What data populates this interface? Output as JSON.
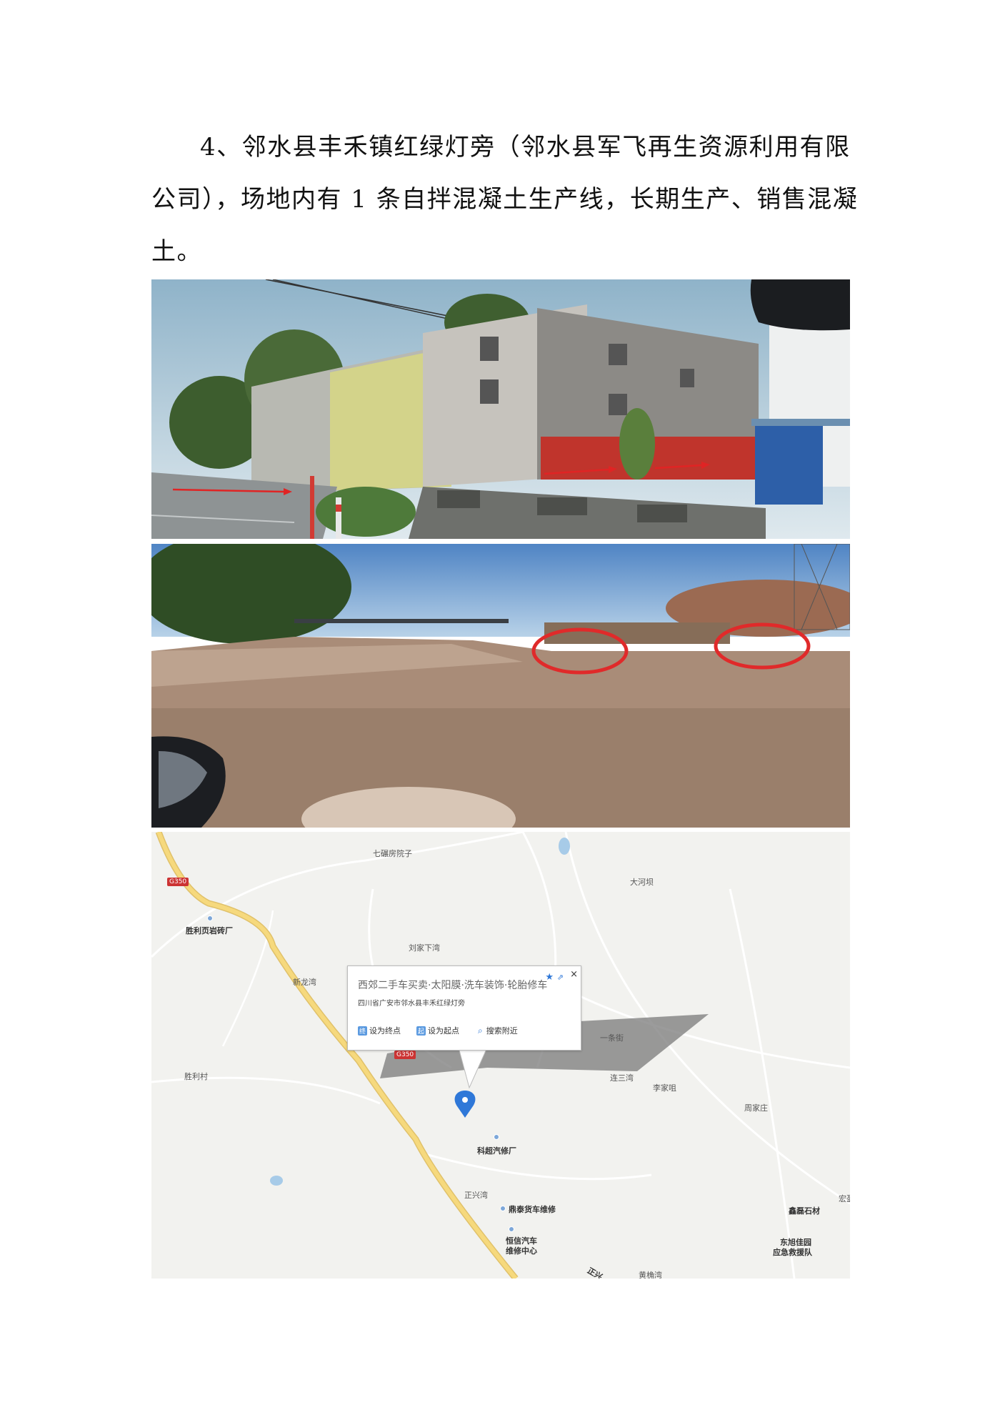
{
  "paragraph": {
    "line1": "4、邻水县丰禾镇红绿灯旁（邻水县军飞再生资源利用有限",
    "line2": "公司），场地内有 1 条自拌混凝土生产线，长期生产、销售混凝",
    "line3": "土。"
  },
  "map": {
    "highway_code": "G350",
    "labels": {
      "qijiafang": "七碾房院子",
      "dahekan": "大河坝",
      "shengli_brick": "胜利页岩砖厂",
      "liujiaxiawan": "刘家下湾",
      "xinlongwan": "新龙湾",
      "yitiaojie": "一条街",
      "liansanwan": "连三湾",
      "lijiazui": "李家咀",
      "zhoujiazhuang": "周家庄",
      "shenglicun": "胜利村",
      "kechao": "科超汽修厂",
      "zhengxingwan": "正兴湾",
      "dingtai": "鼎泰货车维修",
      "hengxin_1": "恒信汽车",
      "hengxin_2": "维修中心",
      "xinlei": "鑫磊石材",
      "hong": "宏盈",
      "dongxu_1": "东旭佳园",
      "dongxu_2": "应急救援队",
      "huangjiawan": "黄桷湾",
      "zhengxing_road": "正兴"
    },
    "popup": {
      "title": "西郊二手车买卖·太阳膜·洗车装饰·轮胎修车",
      "address": "四川省广安市邻水县丰禾红绿灯旁",
      "set_end": "设为终点",
      "set_start": "设为起点",
      "search_near": "搜索附近",
      "end_icon": "终",
      "start_icon": "起",
      "close": "×",
      "star": "★",
      "share": "⇗",
      "search_glyph": "⌕"
    }
  }
}
